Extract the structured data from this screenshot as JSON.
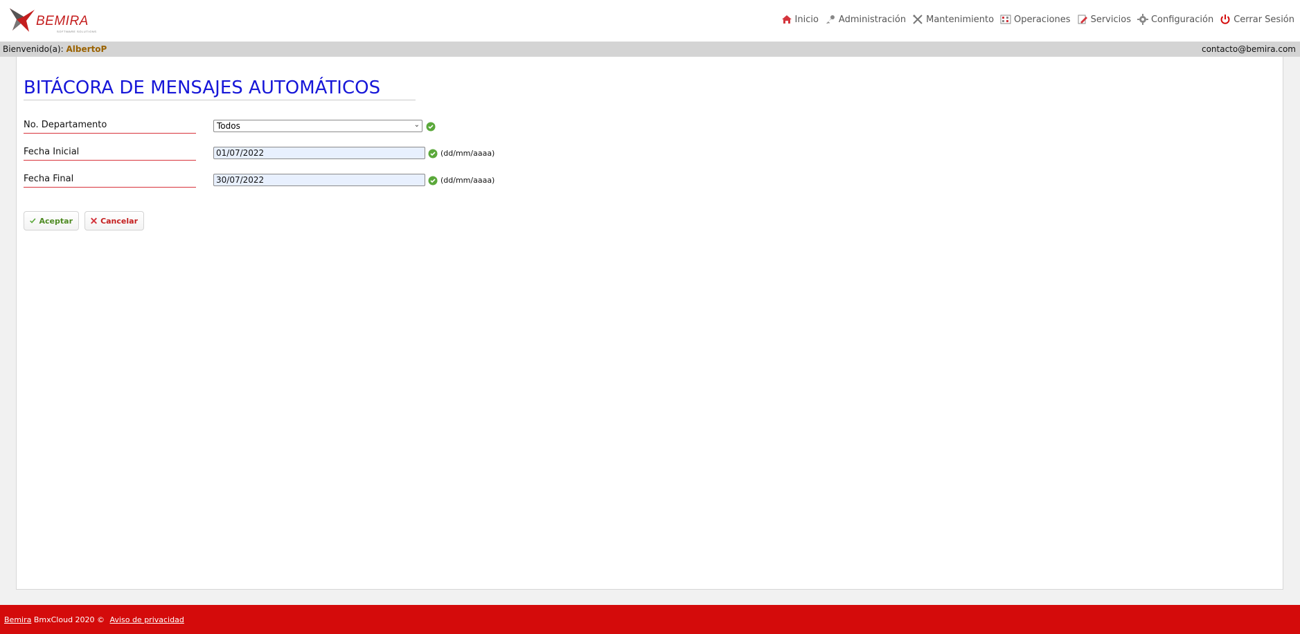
{
  "brand": {
    "logo_text": "BEMIRA",
    "logo_sub": "SOFTWARE SOLUTIONS",
    "red": "#d40b0b",
    "title_blue": "#1616d8"
  },
  "nav": [
    {
      "label": "Inicio",
      "icon": "home-icon"
    },
    {
      "label": "Administración",
      "icon": "key-icon"
    },
    {
      "label": "Mantenimiento",
      "icon": "tools-icon"
    },
    {
      "label": "Operaciones",
      "icon": "grid-icon"
    },
    {
      "label": "Servicios",
      "icon": "edit-icon"
    },
    {
      "label": "Configuración",
      "icon": "gear-icon"
    },
    {
      "label": "Cerrar Sesión",
      "icon": "power-icon"
    }
  ],
  "welcome": {
    "prefix": "Bienvenido(a): ",
    "user": "AlbertoP",
    "email": "contacto@bemira.com"
  },
  "page": {
    "title": "BITÁCORA DE MENSAJES AUTOMÁTICOS"
  },
  "form": {
    "departamento": {
      "label": "No. Departamento",
      "value": "Todos"
    },
    "fecha_inicial": {
      "label": "Fecha Inicial",
      "value": "01/07/2022",
      "hint": "(dd/mm/aaaa)"
    },
    "fecha_final": {
      "label": "Fecha Final",
      "value": "30/07/2022",
      "hint": "(dd/mm/aaaa)"
    }
  },
  "buttons": {
    "accept": "Aceptar",
    "cancel": "Cancelar"
  },
  "footer": {
    "brand_link": "Bemira",
    "copyright": " BmxCloud 2020 © ",
    "privacy": "Aviso de privacidad"
  }
}
